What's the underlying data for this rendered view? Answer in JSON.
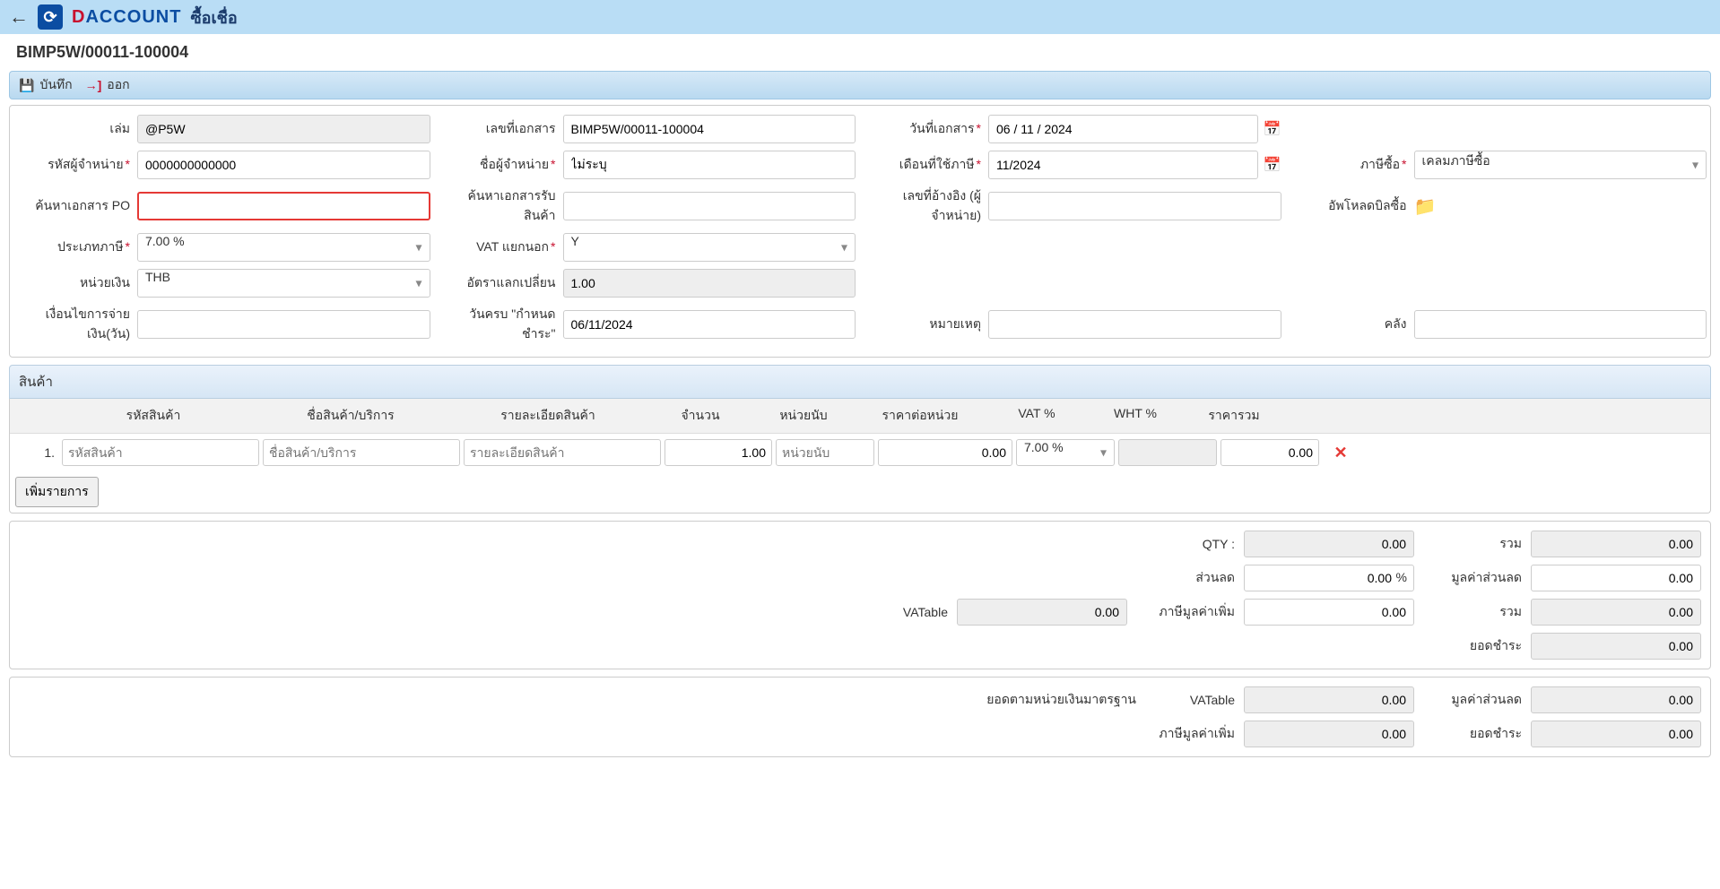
{
  "header": {
    "brand1": "D",
    "brand2": "ACCOUNT",
    "page_title": "ซื้อเชื่อ",
    "doc_number": "BIMP5W/00011-100004"
  },
  "toolbar": {
    "save": "บันทึก",
    "exit": "ออก"
  },
  "form": {
    "labels": {
      "book": "เล่ม",
      "doc_no": "เลขที่เอกสาร",
      "doc_date": "วันที่เอกสาร",
      "vendor_code": "รหัสผู้จำหน่าย",
      "vendor_name": "ชื่อผู้จำหน่าย",
      "tax_month": "เดือนที่ใช้ภาษี",
      "vat_purchase": "ภาษีซื้อ",
      "search_po": "ค้นหาเอกสาร PO",
      "search_gr": "ค้นหาเอกสารรับสินค้า",
      "ref_no": "เลขที่อ้างอิง (ผู้จำหน่าย)",
      "upload_bill": "อัพโหลดบิลซื้อ",
      "tax_type": "ประเภทภาษี",
      "vat_sep": "VAT แยกนอก",
      "currency": "หน่วยเงิน",
      "exch_rate": "อัตราแลกเปลี่ยน",
      "pay_term": "เงื่อนไขการจ่ายเงิน(วัน)",
      "due_date": "วันครบ \"กำหนดชำระ\"",
      "remark": "หมายเหตุ",
      "warehouse": "คลัง"
    },
    "values": {
      "book": "@P5W",
      "doc_no": "BIMP5W/00011-100004",
      "doc_date": "06 / 11 / 2024",
      "vendor_code": "0000000000000",
      "vendor_name": "ไม่ระบุ",
      "tax_month": "11/2024",
      "vat_purchase": "เคลมภาษีซื้อ",
      "tax_type": "7.00 %",
      "vat_sep": "Y",
      "currency": "THB",
      "exch_rate": "1.00",
      "due_date": "06/11/2024"
    }
  },
  "items": {
    "section_title": "สินค้า",
    "headers": {
      "code": "รหัสสินค้า",
      "name": "ชื่อสินค้า/บริการ",
      "desc": "รายละเอียดสินค้า",
      "qty": "จำนวน",
      "unit": "หน่วยนับ",
      "price": "ราคาต่อหน่วย",
      "vat": "VAT %",
      "wht": "WHT %",
      "total": "ราคารวม"
    },
    "placeholders": {
      "code": "รหัสสินค้า",
      "name": "ชื่อสินค้า/บริการ",
      "desc": "รายละเอียดสินค้า",
      "unit": "หน่วยนับ"
    },
    "row": {
      "idx": "1.",
      "qty": "1.00",
      "price": "0.00",
      "vat": "7.00 %",
      "total": "0.00"
    },
    "add_row": "เพิ่มรายการ"
  },
  "totals1": {
    "labels": {
      "qty": "QTY :",
      "sum1": "รวม",
      "discount": "ส่วนลด",
      "discount_amt": "มูลค่าส่วนลด",
      "vatable": "VATable",
      "vat_amt": "ภาษีมูลค่าเพิ่ม",
      "sum2": "รวม",
      "grand": "ยอดชำระ"
    },
    "values": {
      "qty": "0.00",
      "sum1": "0.00",
      "discount": "0.00",
      "discount_amt": "0.00",
      "vatable": "0.00",
      "vat_amt": "0.00",
      "sum2": "0.00",
      "grand": "0.00"
    }
  },
  "totals2": {
    "labels": {
      "std_amt": "ยอดตามหน่วยเงินมาตรฐาน",
      "vatable": "VATable",
      "discount_amt": "มูลค่าส่วนลด",
      "vat_amt": "ภาษีมูลค่าเพิ่ม",
      "grand": "ยอดชำระ"
    },
    "values": {
      "vatable": "0.00",
      "discount_amt": "0.00",
      "vat_amt": "0.00",
      "grand": "0.00"
    }
  }
}
